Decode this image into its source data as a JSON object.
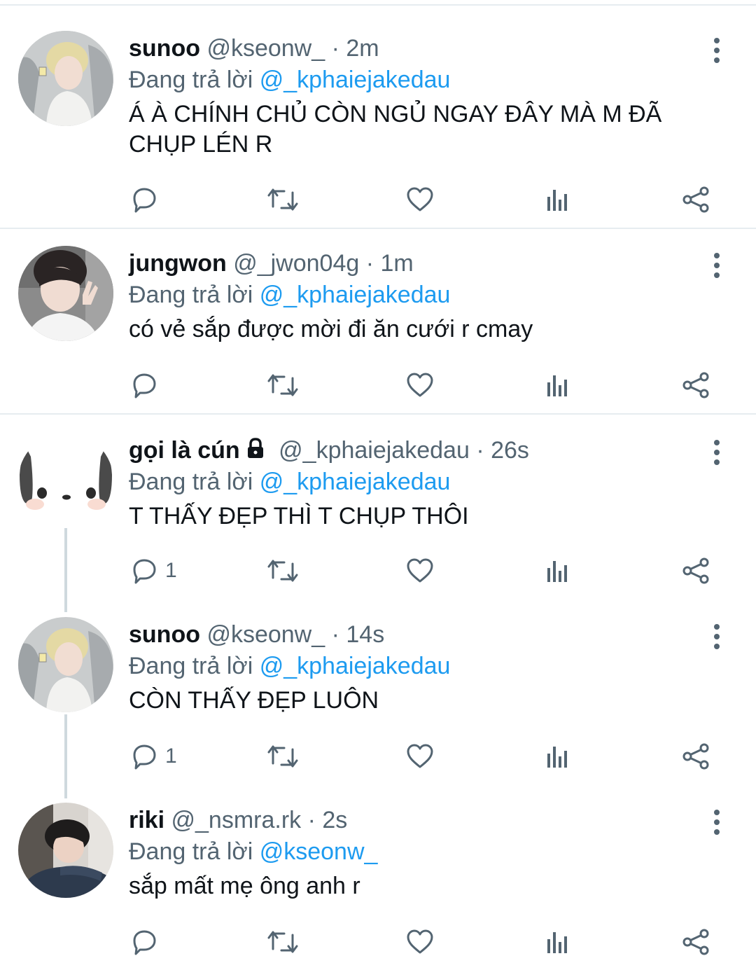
{
  "reply_prefix": "Đang trả lời",
  "tweets": [
    {
      "name": "sunoo",
      "handle": "@kseonw_",
      "separator": "·",
      "time": "2m",
      "reply_to": "@_kphaiejakedau",
      "text": "Á À CHÍNH CHỦ CÒN NGỦ NGAY ĐÂY MÀ M ĐÃ CHỤP LÉN R",
      "reply_count": ""
    },
    {
      "name": "jungwon",
      "handle": "@_jwon04g",
      "separator": "·",
      "time": "1m",
      "reply_to": "@_kphaiejakedau",
      "text": "có vẻ sắp được mời đi ăn cưới r cmay",
      "reply_count": ""
    },
    {
      "name": "gọi là cún",
      "locked": true,
      "handle": "@_kphaiejakedau",
      "separator": "·",
      "time": "26s",
      "reply_to": "@_kphaiejakedau",
      "text": "T THẤY ĐẸP THÌ T CHỤP THÔI",
      "reply_count": "1"
    },
    {
      "name": "sunoo",
      "handle": "@kseonw_",
      "separator": "·",
      "time": "14s",
      "reply_to": "@_kphaiejakedau",
      "text": "CÒN THẤY ĐẸP LUÔN",
      "reply_count": "1"
    },
    {
      "name": "riki",
      "handle": "@_nsmra.rk",
      "separator": "·",
      "time": "2s",
      "reply_to": "@kseonw_",
      "text": "sắp mất mẹ ông anh r",
      "reply_count": ""
    }
  ],
  "icons": {
    "reply": "reply-icon",
    "retweet": "retweet-icon",
    "like": "heart-icon",
    "views": "views-icon",
    "share": "share-icon",
    "more": "more-vertical-icon",
    "lock": "lock-icon"
  },
  "colors": {
    "link": "#1d9bf0",
    "secondary_text": "#536471",
    "primary_text": "#0f1419",
    "divider": "#e6ecf0",
    "thread_line": "#cfd9de"
  }
}
